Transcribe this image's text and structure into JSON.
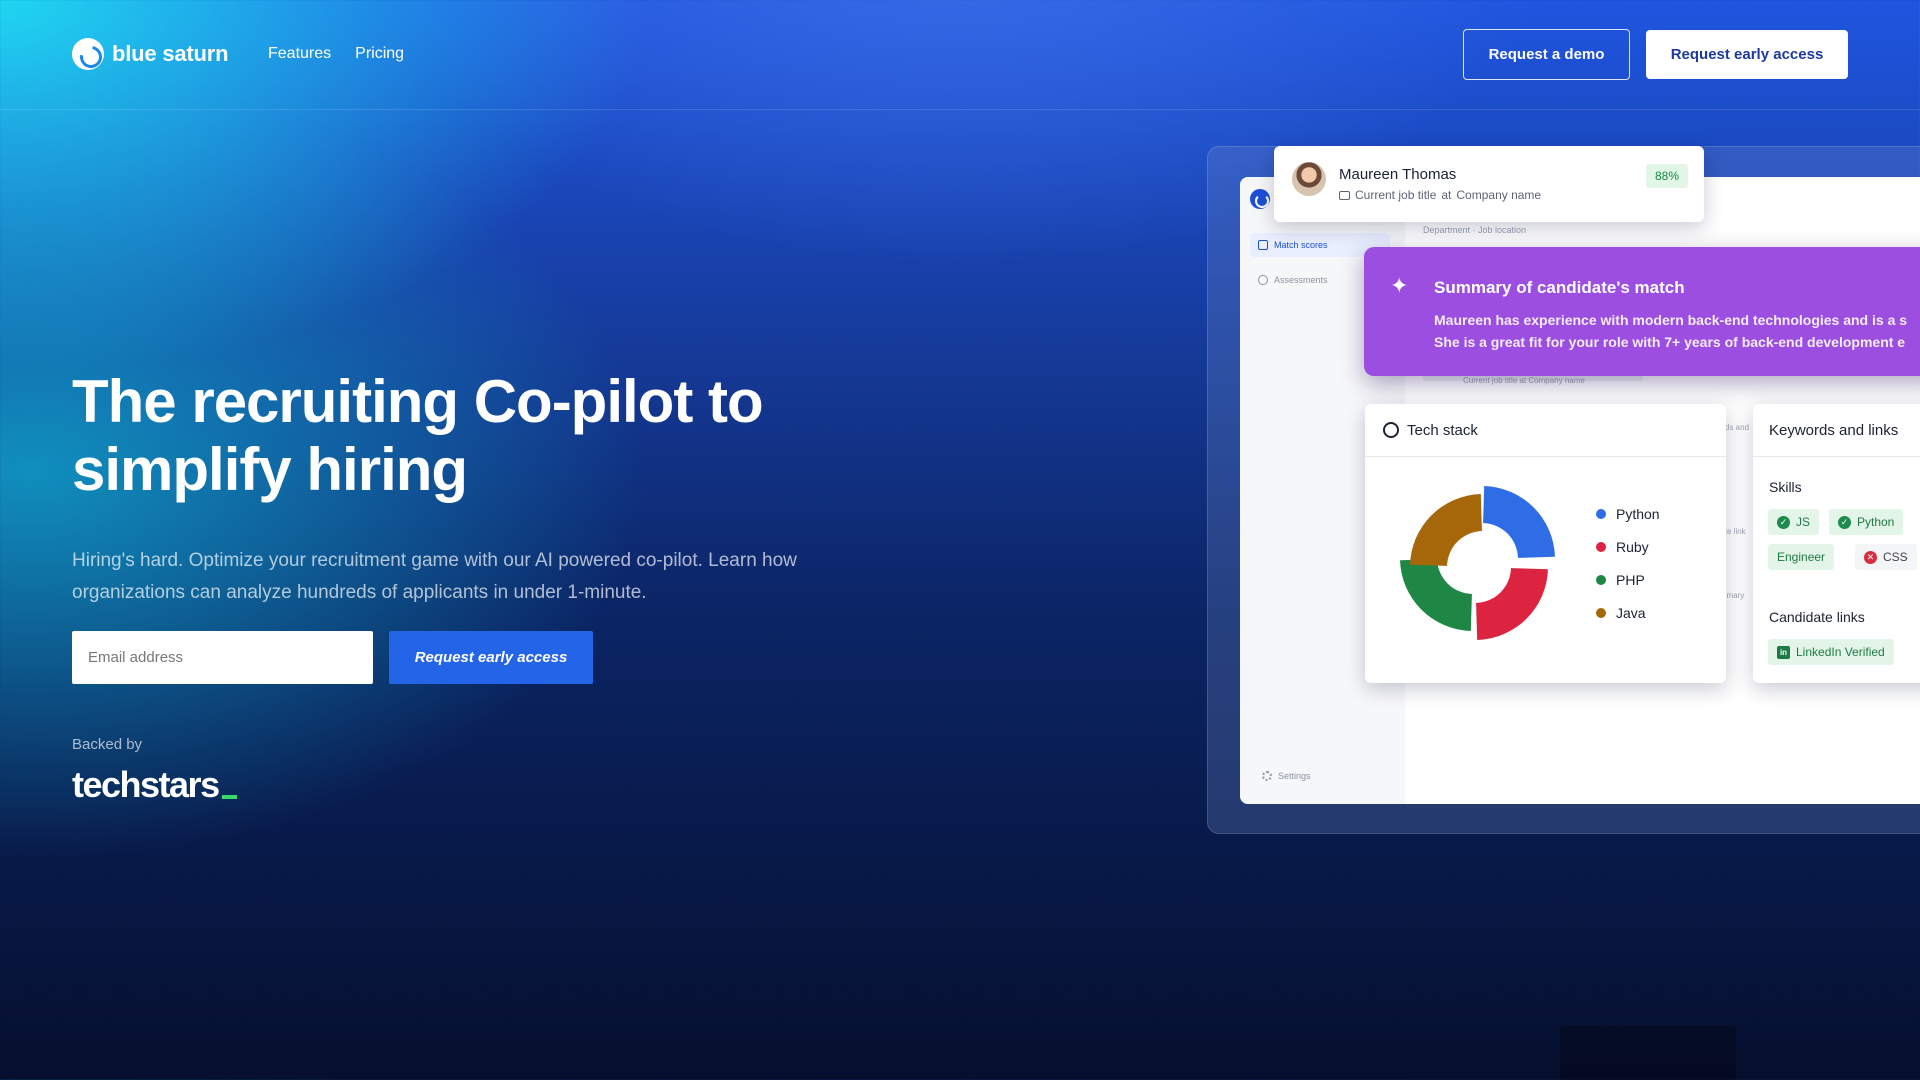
{
  "brand": {
    "name": "blue saturn"
  },
  "nav": {
    "links": [
      "Features",
      "Pricing"
    ],
    "demo_label": "Request a demo",
    "access_label": "Request early access"
  },
  "hero": {
    "title": "The recruiting Co-pilot to simplify hiring",
    "subtitle": "Hiring's hard. Optimize your recruitment game with our AI powered co-pilot. Learn how organizations can analyze hundreds of applicants in under 1-minute.",
    "email_placeholder": "Email address",
    "cta_label": "Request early access",
    "backed_by": "Backed by",
    "backer": "techstars"
  },
  "mockup": {
    "sidebar": {
      "items": [
        "Match scores",
        "Assessments"
      ],
      "settings": "Settings"
    },
    "department_line": "Department · Job location",
    "faded_job_line": "Current job title at Company name",
    "faded_texts": [
      "ds and",
      "ite link",
      "nmary"
    ],
    "profile": {
      "name": "Maureen Thomas",
      "job_title": "Current job title",
      "at": "at",
      "company": "Company name",
      "score": "88%"
    },
    "summary": {
      "title": "Summary of candidate's match",
      "line1": "Maureen has experience with modern back-end technologies and is a s",
      "line2": "She is a great fit for your role with 7+ years of back-end development e"
    },
    "tech_stack": {
      "title": "Tech stack"
    },
    "keywords": {
      "title": "Keywords and links",
      "skills_label": "Skills",
      "skills": [
        {
          "label": "JS",
          "status": "verified"
        },
        {
          "label": "Python",
          "status": "verified"
        },
        {
          "label": "Engineer",
          "status": "neutral"
        },
        {
          "label": "CSS",
          "status": "missing"
        }
      ],
      "links_label": "Candidate links",
      "link": "LinkedIn Verified"
    }
  },
  "chart_data": {
    "type": "pie",
    "variant": "donut",
    "title": "Tech stack",
    "categories": [
      "Python",
      "Ruby",
      "PHP",
      "Java"
    ],
    "values": [
      25,
      25,
      25,
      25
    ],
    "colors": [
      "#2f6de6",
      "#dc2340",
      "#1e8745",
      "#a6670a"
    ]
  }
}
